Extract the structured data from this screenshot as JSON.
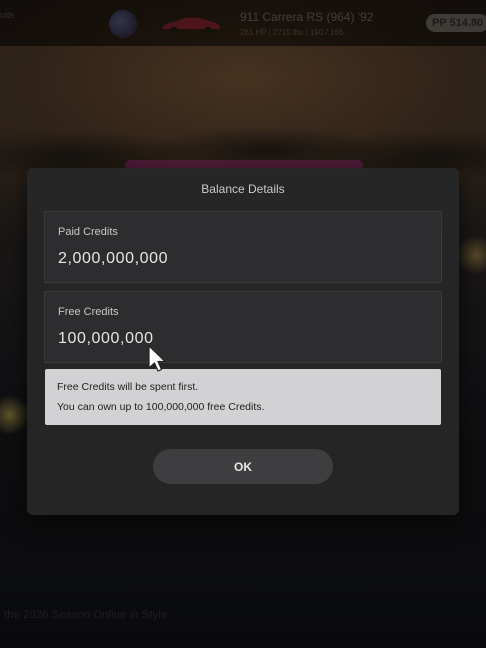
{
  "topbar": {
    "corner_text": "uits",
    "car_name": "911 Carrera RS (964) '92",
    "car_specs": "261 HP | 2715 lbs | 190 / 166",
    "pp_badge": "PP 514.80"
  },
  "background": {
    "bottom_text": "the 2026 Season Online in Style"
  },
  "dialog": {
    "title": "Balance Details",
    "paid": {
      "label": "Paid Credits",
      "value": "2,000,000,000"
    },
    "free": {
      "label": "Free Credits",
      "value": "100,000,000"
    },
    "info": [
      "Free Credits will be spent first.",
      "You can own up to 100,000,000 free Credits."
    ],
    "ok_label": "OK"
  },
  "colors": {
    "dialog_bg": "#262628",
    "info_bg": "#d2d2d4",
    "button_bg": "#3e3e40"
  },
  "icons": {
    "cursor": "mouse-pointer-icon",
    "badge": "manufacturer-badge-icon",
    "car": "car-thumbnail-icon"
  }
}
